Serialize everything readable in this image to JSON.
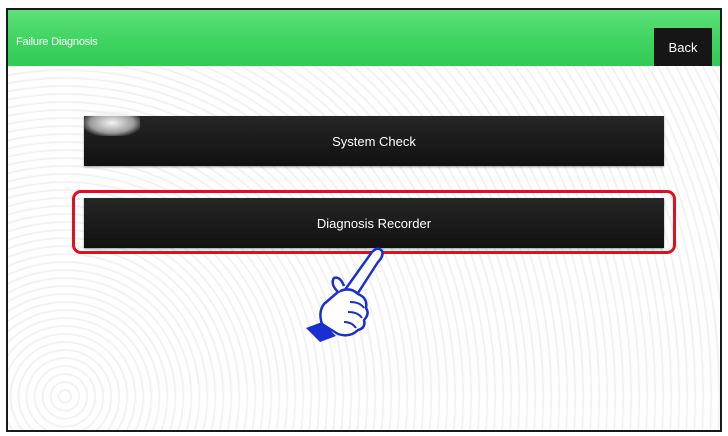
{
  "header": {
    "title": "Failure Diagnosis",
    "back_label": "Back"
  },
  "menu": {
    "items": [
      {
        "label": "System Check"
      },
      {
        "label": "Diagnosis Recorder"
      }
    ]
  },
  "icons": {
    "pointer": "pointing-hand-icon"
  },
  "colors": {
    "header_green": "#3cd35f",
    "button_black": "#161616",
    "highlight_red": "#e01020",
    "hand_blue": "#1a2fd0"
  }
}
